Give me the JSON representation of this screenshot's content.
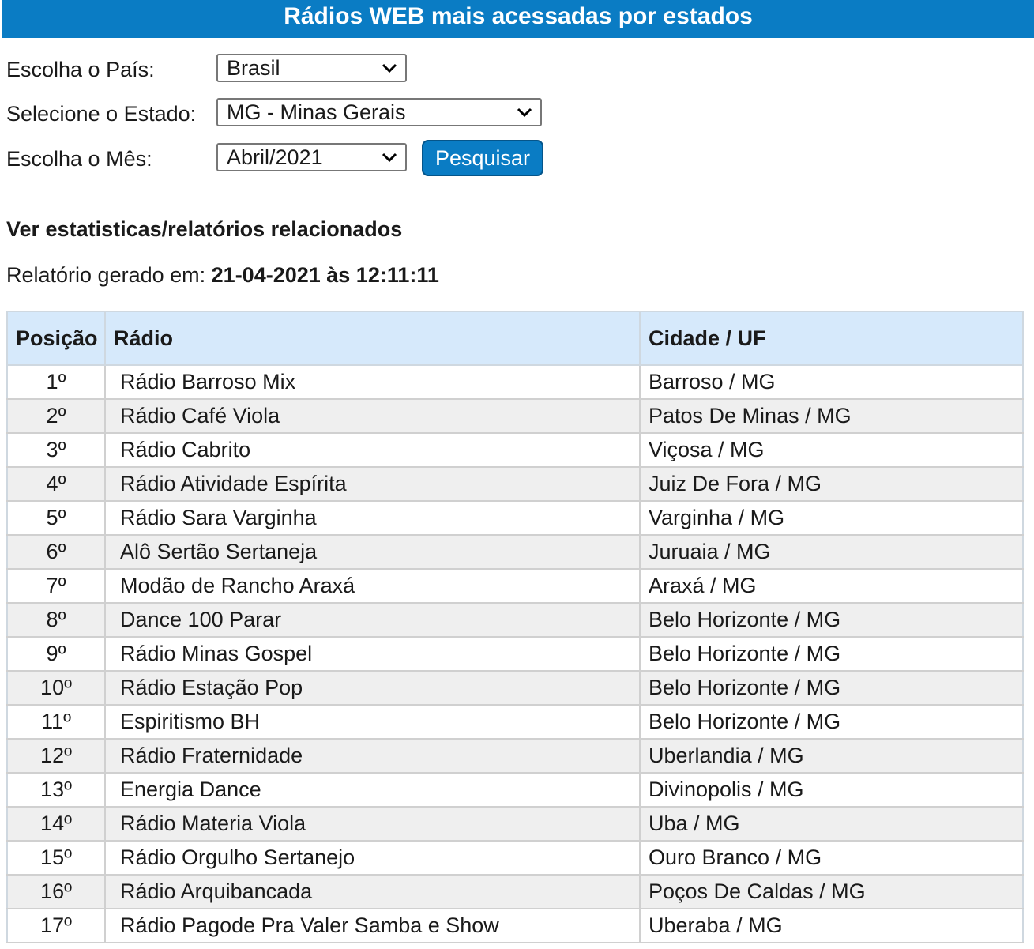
{
  "header": {
    "title": "Rádios WEB mais acessadas por estados"
  },
  "form": {
    "country_label": "Escolha o País:",
    "country_value": "Brasil",
    "state_label": "Selecione o Estado:",
    "state_value": "MG - Minas Gerais",
    "month_label": "Escolha o Mês:",
    "month_value": "Abril/2021",
    "search_button": "Pesquisar"
  },
  "related": {
    "heading": "Ver estatisticas/relatórios relacionados"
  },
  "report": {
    "generated_label": "Relatório gerado em:",
    "generated_value": "21-04-2021 às 12:11:11"
  },
  "table": {
    "headers": [
      "Posição",
      "Rádio",
      "Cidade / UF"
    ],
    "rows": [
      {
        "pos": "1º",
        "radio": "Rádio Barroso Mix",
        "city": "Barroso / MG"
      },
      {
        "pos": "2º",
        "radio": "Rádio Café Viola",
        "city": "Patos De Minas / MG"
      },
      {
        "pos": "3º",
        "radio": "Rádio Cabrito",
        "city": "Viçosa / MG"
      },
      {
        "pos": "4º",
        "radio": "Rádio Atividade Espírita",
        "city": "Juiz De Fora / MG"
      },
      {
        "pos": "5º",
        "radio": "Rádio Sara Varginha",
        "city": "Varginha / MG"
      },
      {
        "pos": "6º",
        "radio": "Alô Sertão Sertaneja",
        "city": "Juruaia / MG"
      },
      {
        "pos": "7º",
        "radio": "Modão de Rancho Araxá",
        "city": "Araxá / MG"
      },
      {
        "pos": "8º",
        "radio": "Dance 100 Parar",
        "city": "Belo Horizonte / MG"
      },
      {
        "pos": "9º",
        "radio": "Rádio Minas Gospel",
        "city": "Belo Horizonte / MG"
      },
      {
        "pos": "10º",
        "radio": "Rádio Estação Pop",
        "city": "Belo Horizonte / MG"
      },
      {
        "pos": "11º",
        "radio": "Espiritismo BH",
        "city": "Belo Horizonte / MG"
      },
      {
        "pos": "12º",
        "radio": "Rádio Fraternidade",
        "city": "Uberlandia / MG"
      },
      {
        "pos": "13º",
        "radio": "Energia Dance",
        "city": "Divinopolis / MG"
      },
      {
        "pos": "14º",
        "radio": "Rádio Materia Viola",
        "city": "Uba / MG"
      },
      {
        "pos": "15º",
        "radio": "Rádio Orgulho Sertanejo",
        "city": "Ouro Branco / MG"
      },
      {
        "pos": "16º",
        "radio": "Rádio Arquibancada",
        "city": "Poços De Caldas / MG"
      },
      {
        "pos": "17º",
        "radio": "Rádio Pagode Pra Valer Samba e Show",
        "city": "Uberaba / MG"
      }
    ]
  }
}
